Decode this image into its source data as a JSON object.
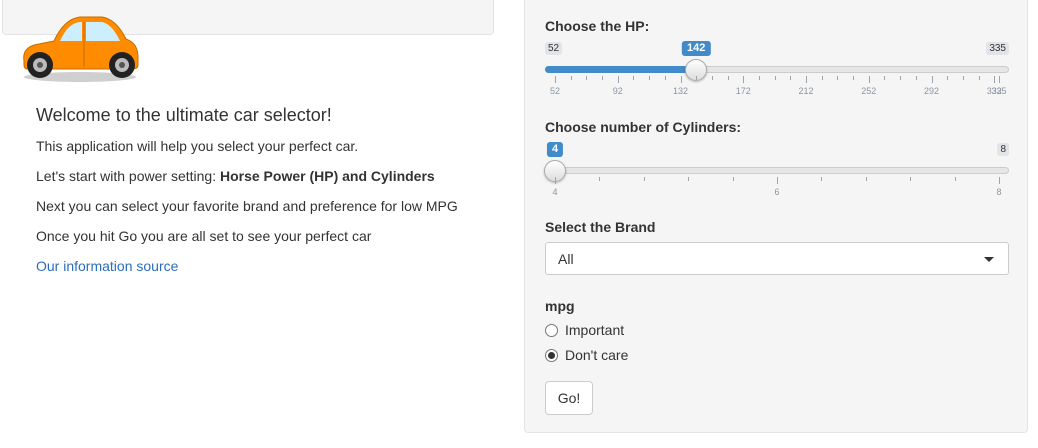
{
  "intro": {
    "heading": "Welcome to the ultimate car selector!",
    "line1": "This application will help you select your perfect car.",
    "line2_prefix": "Let's start with power setting: ",
    "line2_bold": "Horse Power (HP) and Cylinders",
    "line3": "Next you can select your favorite brand and preference for low MPG",
    "line4": "Once you hit Go you are all set to see your perfect car",
    "link": "Our information source"
  },
  "logo": {
    "icon": "car-icon",
    "body_color": "#ff8c00"
  },
  "hp_slider": {
    "label": "Choose the HP:",
    "min": 52,
    "max": 335,
    "value": 142,
    "min_label": "52",
    "max_label": "335",
    "value_label": "142",
    "ticks": [
      "52",
      "92",
      "132",
      "172",
      "212",
      "252",
      "292",
      "332",
      "335"
    ],
    "accent": "#428bca"
  },
  "cyl_slider": {
    "label": "Choose number of Cylinders:",
    "min": 4,
    "max": 8,
    "value": 4,
    "min_label": "4",
    "max_label": "8",
    "value_label": "4",
    "ticks": [
      "4",
      "6",
      "8"
    ]
  },
  "brand": {
    "label": "Select the Brand",
    "selected": "All"
  },
  "mpg": {
    "label": "mpg",
    "options": [
      {
        "label": "Important",
        "checked": false
      },
      {
        "label": "Don't care",
        "checked": true
      }
    ]
  },
  "go_button": {
    "label": "Go!"
  }
}
